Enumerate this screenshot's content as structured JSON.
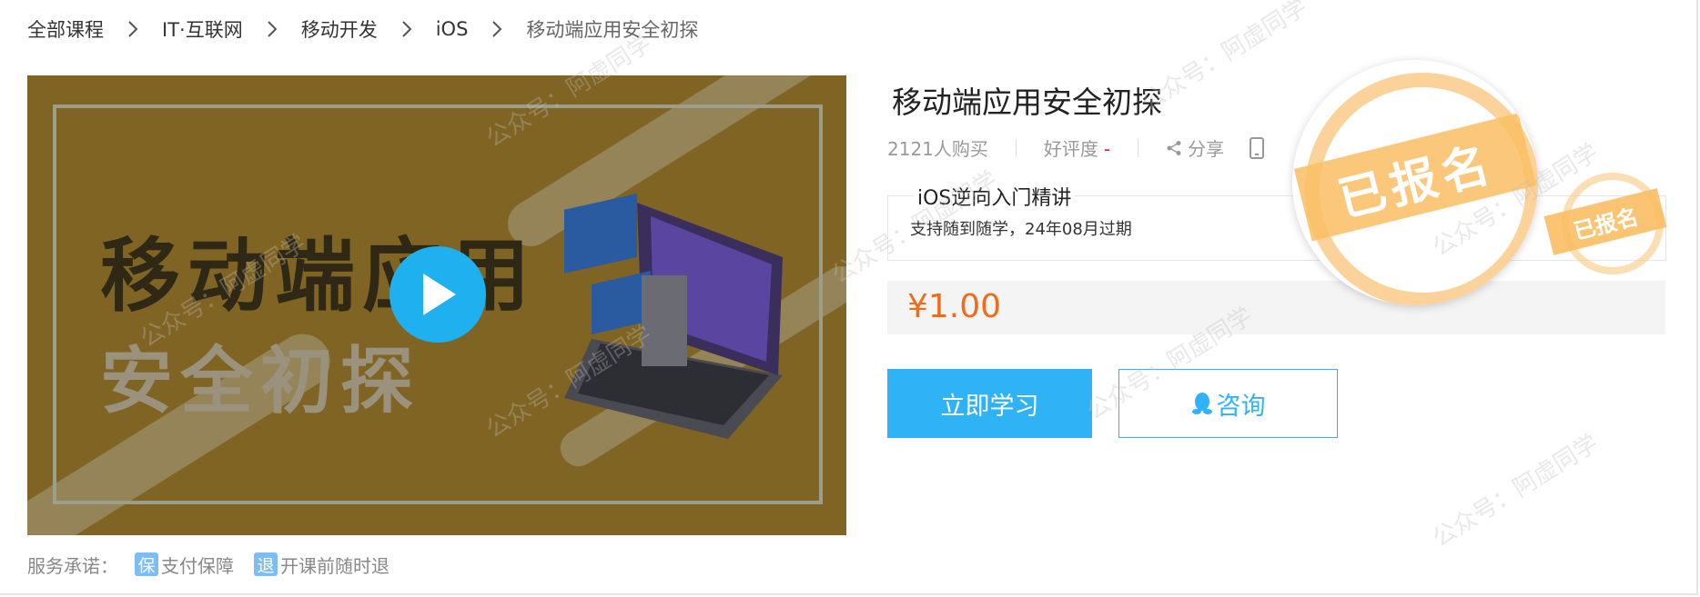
{
  "breadcrumb": {
    "items": [
      {
        "label": "全部课程"
      },
      {
        "label": "IT·互联网"
      },
      {
        "label": "移动开发"
      },
      {
        "label": "iOS"
      },
      {
        "label": "移动端应用安全初探"
      }
    ]
  },
  "cover": {
    "title_line1": "移动端应用",
    "title_line2": "安全初探",
    "play_icon": "play-icon"
  },
  "course": {
    "title": "移动端应用安全初探",
    "buyers": "2121人购买",
    "rating_label": "好评度",
    "rating_value": "-",
    "share_label": "分享",
    "plan_name": "iOS逆向入门精讲",
    "plan_desc": "支持随到随学，24年08月过期",
    "price": "¥1.00",
    "study_button": "立即学习",
    "consult_button": "咨询",
    "stamp_text": "已报名"
  },
  "service": {
    "label": "服务承诺：",
    "items": [
      {
        "icon_char": "保",
        "text": "支付保障"
      },
      {
        "icon_char": "退",
        "text": "开课前随时退"
      }
    ]
  },
  "watermark": "公众号：阿虚同学",
  "colors": {
    "accent": "#2fb3f6",
    "price": "#ef6c1a",
    "stamp": "#fac478"
  }
}
